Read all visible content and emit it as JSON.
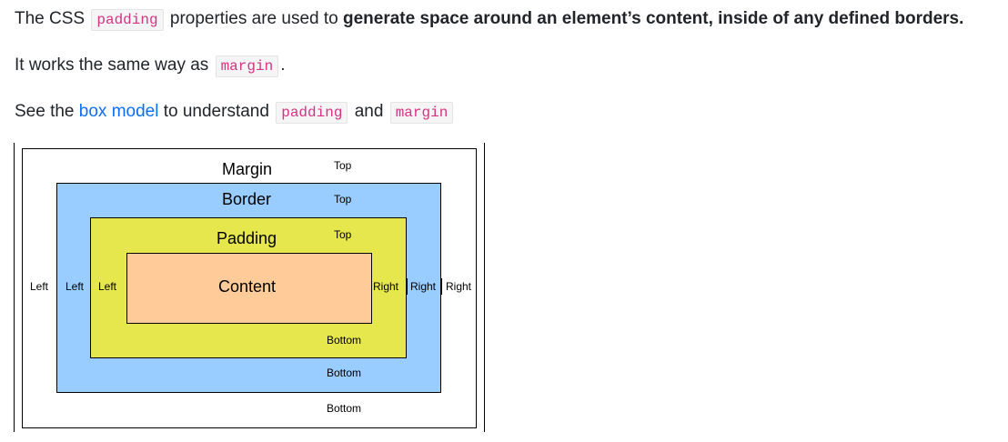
{
  "intro": {
    "p1_prefix": "The CSS",
    "p1_code": "padding",
    "p1_mid": "properties are used to",
    "p1_bold": "generate space around an element’s content, inside of any defined borders."
  },
  "line2": {
    "prefix": "It works the same way as",
    "code": "margin",
    "suffix": "."
  },
  "line3": {
    "prefix": "See the",
    "link": "box model",
    "mid": "to understand",
    "code1": "padding",
    "and": "and",
    "code2": "margin"
  },
  "diagram": {
    "margin_label": "Margin",
    "border_label": "Border",
    "padding_label": "Padding",
    "content_label": "Content",
    "top": "Top",
    "bottom": "Bottom",
    "left": "Left",
    "right": "Right",
    "colors": {
      "margin": "#ffffff",
      "border": "#99ccff",
      "padding": "#e6e64d",
      "content": "#ffcc99"
    }
  }
}
